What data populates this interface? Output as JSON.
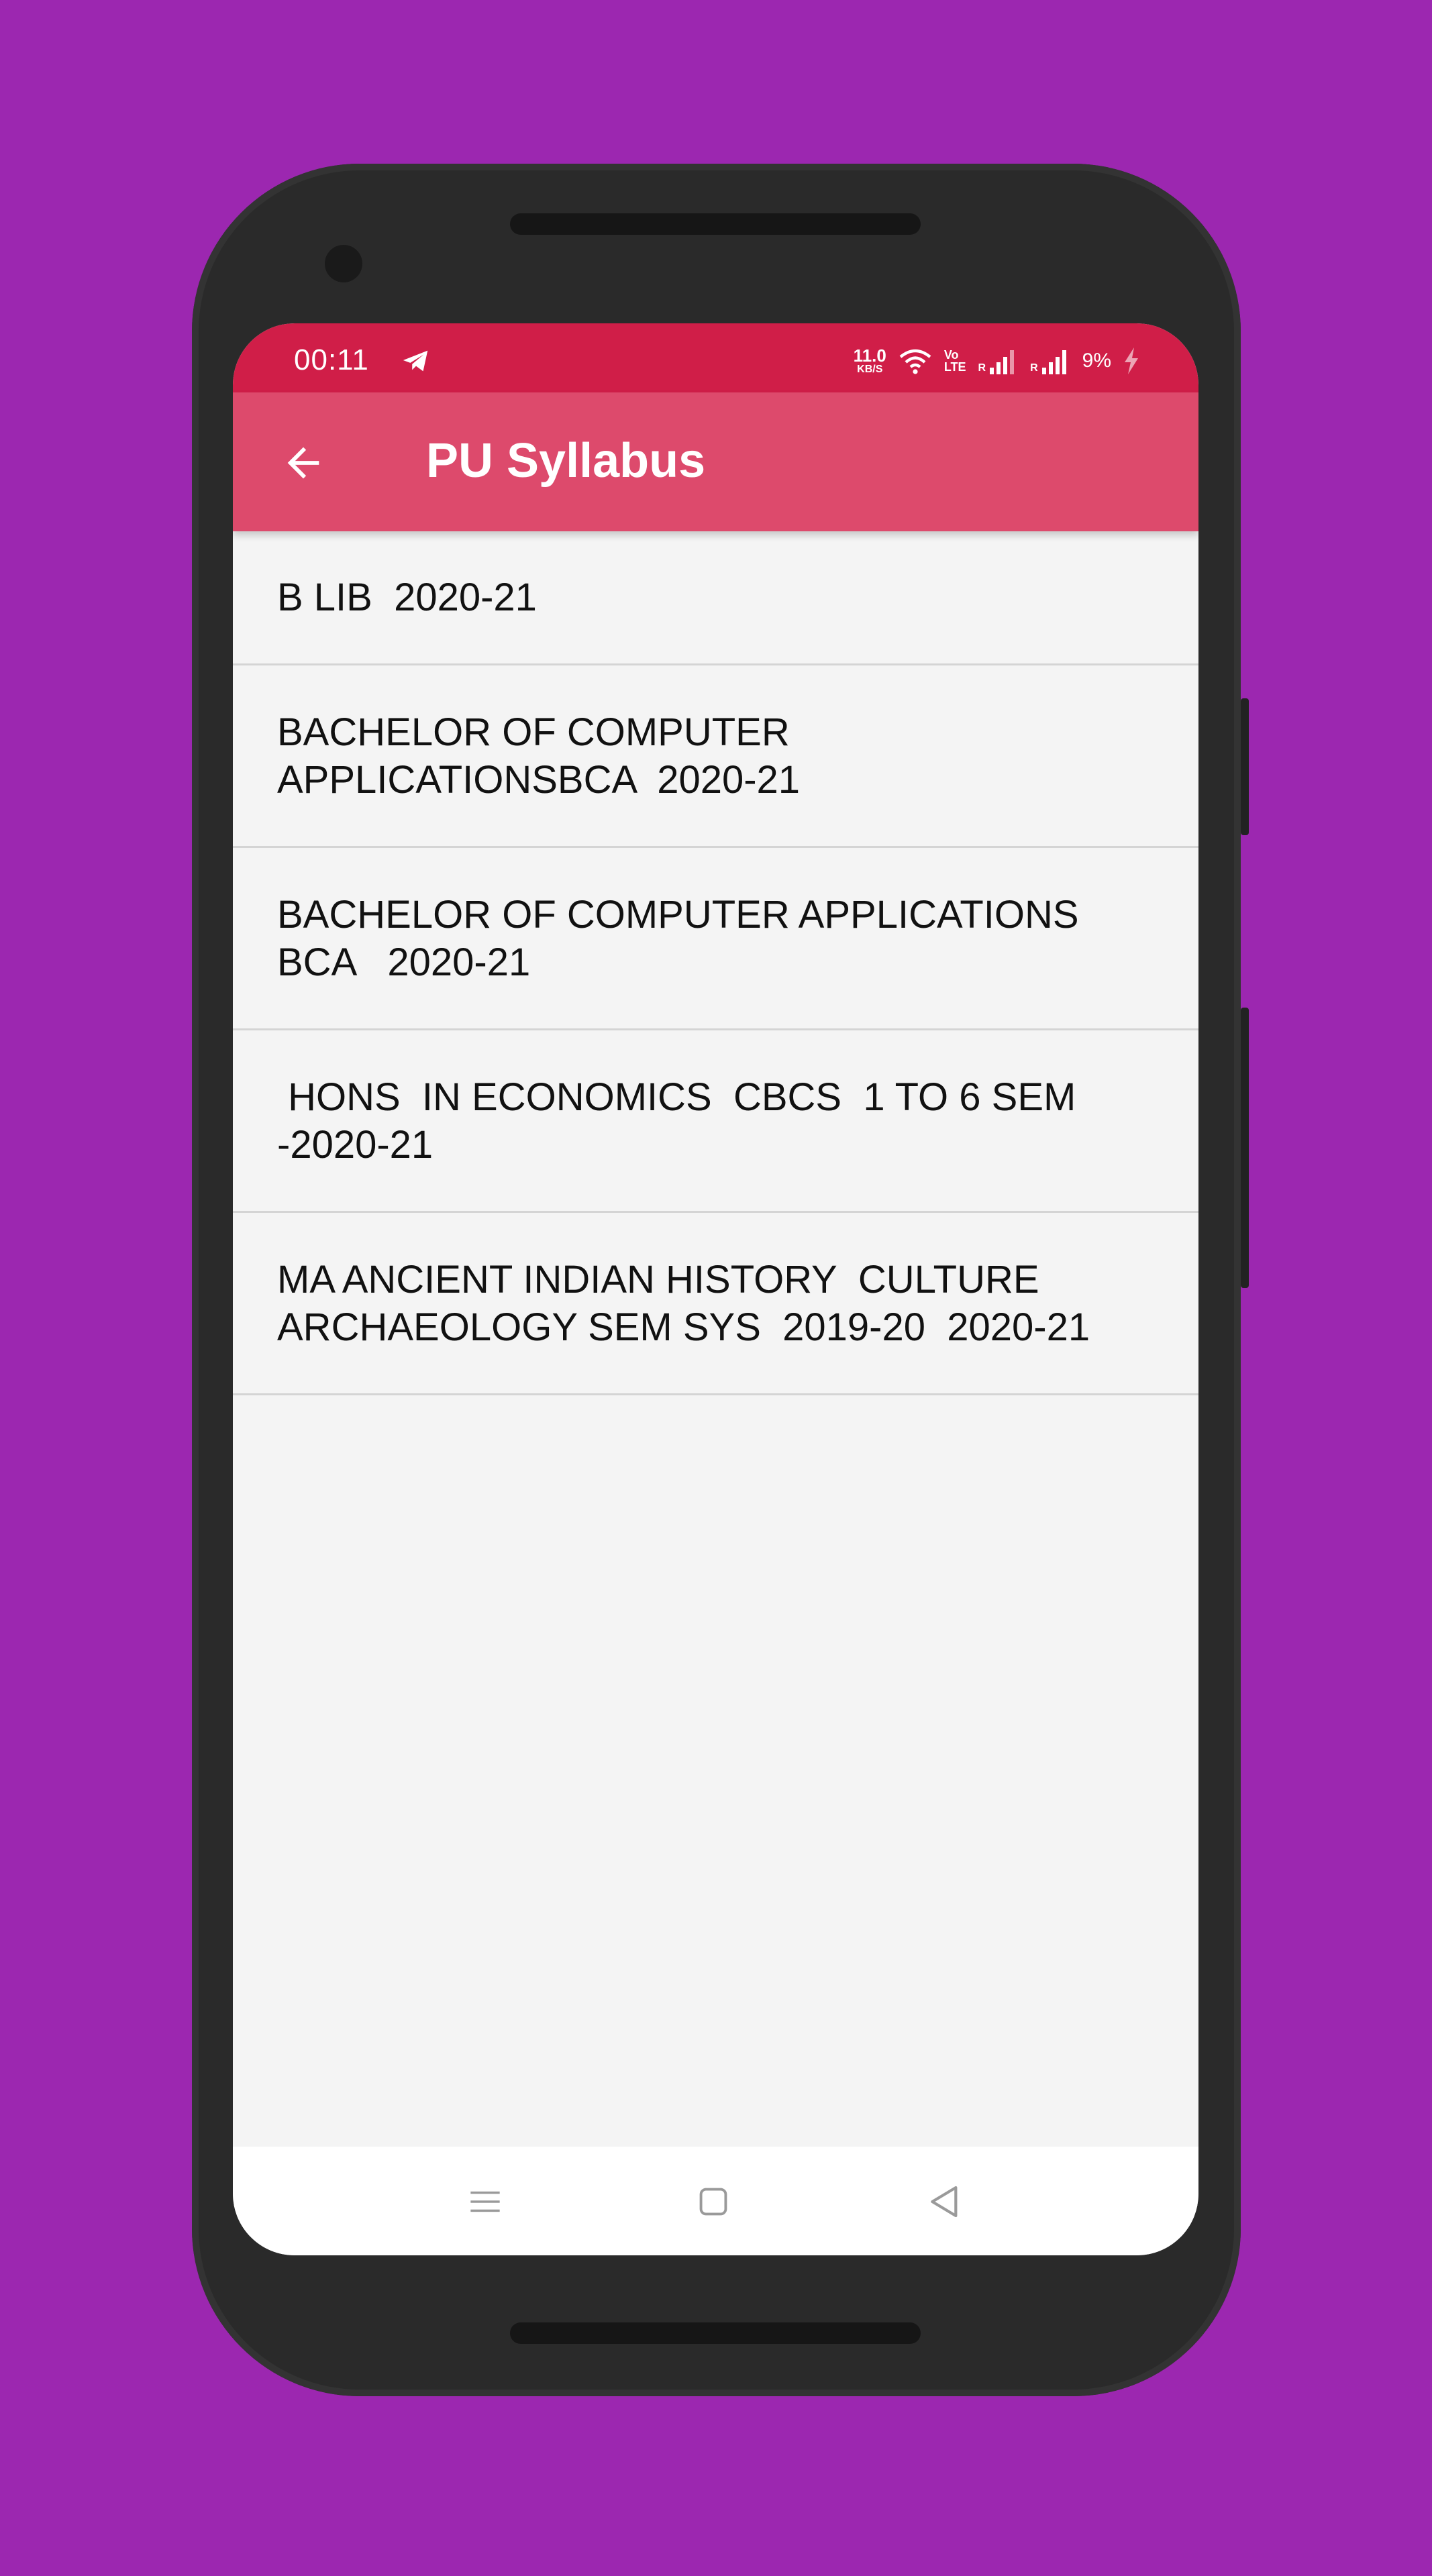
{
  "status_bar": {
    "time": "00:11",
    "telegram_icon": "telegram-icon",
    "speed_value": "11.0",
    "speed_unit": "KB/S",
    "volte_top": "Vo",
    "volte_bottom": "LTE",
    "roaming_1": "R",
    "roaming_2": "R",
    "battery": "9%"
  },
  "app_bar": {
    "title": "PU Syllabus",
    "back_icon": "arrow-back-icon"
  },
  "list": {
    "items": [
      {
        "text": "B LIB  2020-21"
      },
      {
        "text": "BACHELOR OF COMPUTER\nAPPLICATIONSBCA  2020-21"
      },
      {
        "text": "BACHELOR OF COMPUTER APPLICATIONS\nBCA   2020-21"
      },
      {
        "text": " HONS  IN ECONOMICS  CBCS  1 TO 6 SEM\n-2020-21"
      },
      {
        "text": "MA ANCIENT INDIAN HISTORY  CULTURE\nARCHAEOLOGY SEM SYS  2019-20  2020-21"
      }
    ]
  },
  "nav_bar": {
    "menu_icon": "menu-icon",
    "home_icon": "home-square-icon",
    "back_icon": "back-triangle-icon"
  },
  "colors": {
    "background": "#9c27b0",
    "status_bar": "#d01e48",
    "app_bar": "#dd4a6c",
    "list_background": "#f4f4f4"
  }
}
